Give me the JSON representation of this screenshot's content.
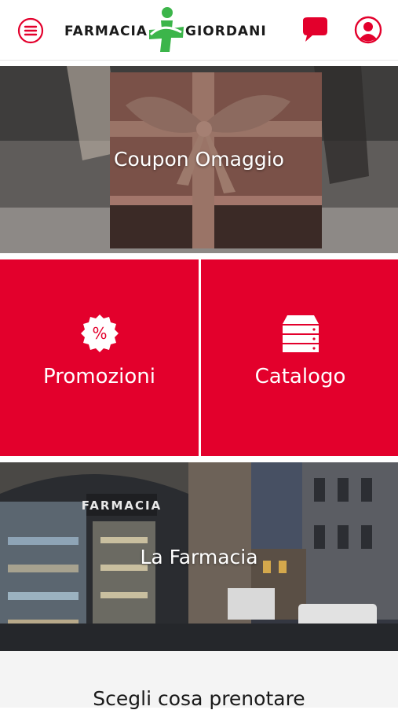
{
  "header": {
    "brand_left": "FARMACIA",
    "brand_right": "GIORDANI",
    "menu_icon": "hamburger-menu-icon",
    "chat_icon": "chat-bubble-icon",
    "user_icon": "user-profile-icon"
  },
  "panels": {
    "coupon": {
      "label": "Coupon Omaggio"
    },
    "promozioni": {
      "label": "Promozioni",
      "icon": "percent-badge-icon"
    },
    "catalogo": {
      "label": "Catalogo",
      "icon": "catalog-drawers-icon"
    },
    "farmacia": {
      "label": "La Farmacia"
    }
  },
  "booking": {
    "title": "Scegli cosa prenotare"
  },
  "colors": {
    "brand_red": "#e3002c",
    "brand_green": "#3cb54a"
  }
}
